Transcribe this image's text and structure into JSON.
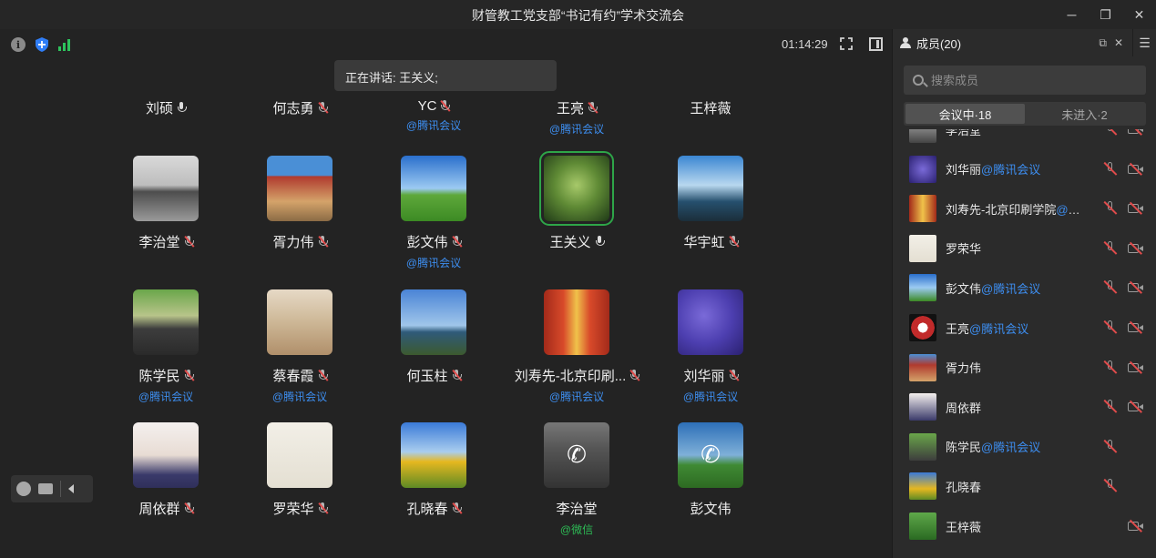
{
  "window": {
    "title": "财管教工党支部“书记有约”学术交流会",
    "buttons": [
      "─",
      "❐",
      "✕"
    ]
  },
  "toolbar": {
    "info_icon": "i",
    "timer": "01:14:29"
  },
  "speaking": {
    "text": "正在讲话: 王关义;"
  },
  "top_row": [
    {
      "name": "刘硕",
      "mic": "on",
      "sub": ""
    },
    {
      "name": "何志勇",
      "mic": "off",
      "sub": ""
    },
    {
      "name": "YC",
      "mic": "off",
      "sub": "@腾讯会议"
    },
    {
      "name": "王亮",
      "mic": "off",
      "sub": "@腾讯会议"
    },
    {
      "name": "王梓薇",
      "mic": "none",
      "sub": ""
    }
  ],
  "grid": [
    {
      "name": "李治堂",
      "mic": "off",
      "sub": ""
    },
    {
      "name": "胥力伟",
      "mic": "off",
      "sub": ""
    },
    {
      "name": "彭文伟",
      "mic": "off",
      "sub": "@腾讯会议"
    },
    {
      "name": "王关义",
      "mic": "on",
      "sub": "",
      "active": true
    },
    {
      "name": "华宇虹",
      "mic": "off",
      "sub": ""
    },
    {
      "name": "陈学民",
      "mic": "off",
      "sub": "@腾讯会议"
    },
    {
      "name": "蔡春霞",
      "mic": "off",
      "sub": "@腾讯会议"
    },
    {
      "name": "何玉柱",
      "mic": "off",
      "sub": ""
    },
    {
      "name": "刘寿先-北京印刷...",
      "mic": "off",
      "sub": "@腾讯会议"
    },
    {
      "name": "刘华丽",
      "mic": "off",
      "sub": "@腾讯会议"
    },
    {
      "name": "周依群",
      "mic": "off",
      "sub": ""
    },
    {
      "name": "罗荣华",
      "mic": "off",
      "sub": ""
    },
    {
      "name": "孔晓春",
      "mic": "off",
      "sub": ""
    },
    {
      "name": "李治堂",
      "mic": "none",
      "sub": "@微信",
      "sub_type": "wx",
      "phone": true
    },
    {
      "name": "彭文伟",
      "mic": "none",
      "sub": "",
      "phone": true
    }
  ],
  "sidebar": {
    "header": "成员(20)",
    "search_placeholder": "搜索成员",
    "tabs": [
      "会议中·18",
      "未进入·2"
    ],
    "members": [
      {
        "name": "李治堂",
        "tag": "",
        "mic_off": true,
        "cam_off": true
      },
      {
        "name": "刘华丽",
        "tag": "@腾讯会议",
        "mic_off": true,
        "cam_off": true
      },
      {
        "name": "刘寿先-北京印刷学院",
        "tag": "@腾...",
        "mic_off": true,
        "cam_off": true
      },
      {
        "name": "罗荣华",
        "tag": "",
        "mic_off": true,
        "cam_off": true
      },
      {
        "name": "彭文伟",
        "tag": "@腾讯会议",
        "mic_off": true,
        "cam_off": true
      },
      {
        "name": "王亮",
        "tag": "@腾讯会议",
        "mic_off": true,
        "cam_off": true
      },
      {
        "name": "胥力伟",
        "tag": "",
        "mic_off": true,
        "cam_off": true
      },
      {
        "name": "周依群",
        "tag": "",
        "mic_off": true,
        "cam_off": true
      },
      {
        "name": "陈学民",
        "tag": "@腾讯会议",
        "mic_off": true,
        "cam_off": false
      },
      {
        "name": "孔晓春",
        "tag": "",
        "mic_off": true,
        "cam_off": false
      },
      {
        "name": "王梓薇",
        "tag": "",
        "mic_off": false,
        "cam_off": true
      }
    ]
  }
}
